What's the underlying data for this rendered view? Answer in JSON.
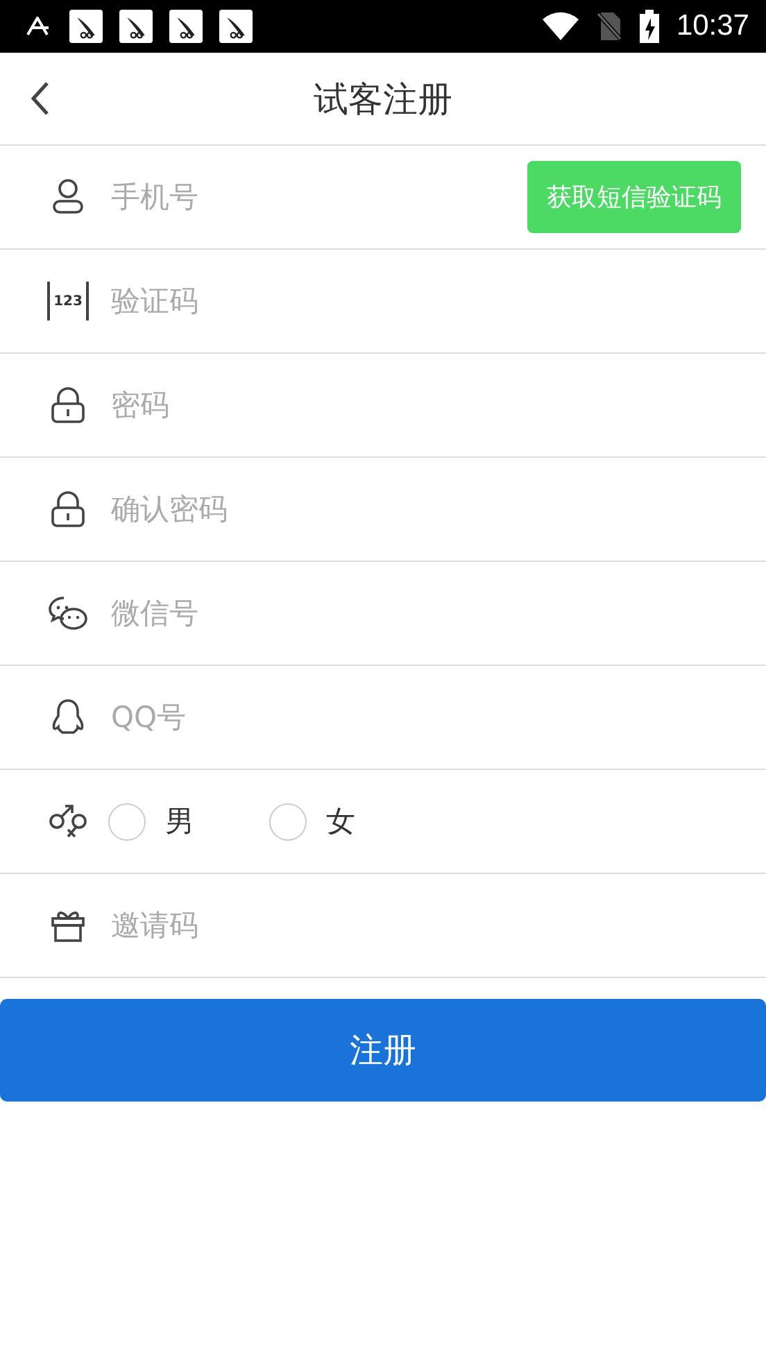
{
  "status_bar": {
    "time": "10:37"
  },
  "header": {
    "title": "试客注册"
  },
  "rows": [
    {
      "kind": "phone",
      "placeholder": "手机号",
      "action": "获取短信验证码"
    },
    {
      "kind": "code",
      "icon_text": "123",
      "placeholder": "验证码"
    },
    {
      "kind": "password",
      "placeholder": "密码"
    },
    {
      "kind": "password",
      "placeholder": "确认密码"
    },
    {
      "kind": "wechat",
      "placeholder": "微信号"
    },
    {
      "kind": "qq",
      "placeholder": "QQ号"
    },
    {
      "kind": "gender",
      "options": [
        {
          "label": "男",
          "selected": false
        },
        {
          "label": "女",
          "selected": false
        }
      ]
    },
    {
      "kind": "invite",
      "placeholder": "邀请码"
    }
  ],
  "submit": "注册"
}
